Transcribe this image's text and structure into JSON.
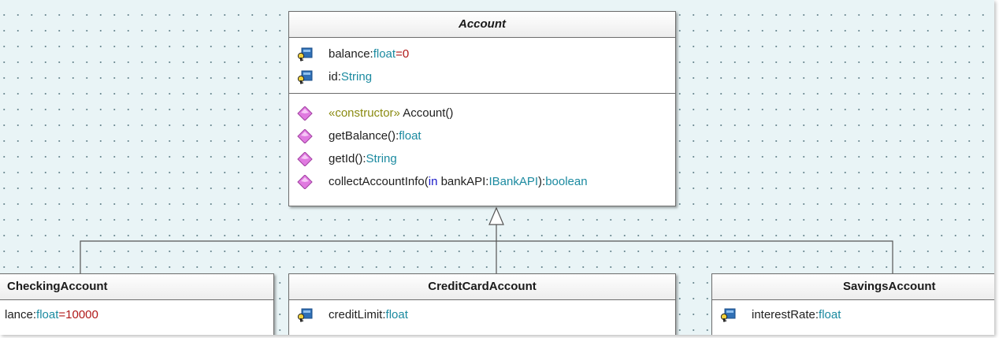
{
  "diagram": {
    "classes": {
      "account": {
        "name": "Account",
        "attributes": [
          {
            "name": "balance",
            "sep": ":",
            "type": "float",
            "eq": "=",
            "default": "0",
            "icon": "attribute-key-icon"
          },
          {
            "name": "id",
            "sep": ":",
            "type": "String",
            "icon": "attribute-key-icon"
          }
        ],
        "operations": [
          {
            "stereotype": "«constructor»",
            "name": " Account()",
            "icon": "operation-diamond-icon"
          },
          {
            "name": "getBalance()",
            "sep": ":",
            "type": "float",
            "icon": "operation-diamond-icon"
          },
          {
            "name": "getId()",
            "sep": ":",
            "type": "String",
            "icon": "operation-diamond-icon"
          },
          {
            "name": "collectAccountInfo(",
            "kw": "in",
            "param": " bankAPI",
            "sep": ":",
            "ptype": "IBankAPI",
            "close": "):",
            "type": "boolean",
            "icon": "operation-diamond-icon"
          }
        ]
      },
      "checking": {
        "name": "CheckingAccount",
        "attributes": [
          {
            "name": "lance",
            "sep": ":",
            "type": "float",
            "eq": "=",
            "default": "10000"
          }
        ]
      },
      "creditcard": {
        "name": "CreditCardAccount",
        "attributes": [
          {
            "name": "creditLimit",
            "sep": ":",
            "type": "float",
            "icon": "attribute-key-icon"
          }
        ]
      },
      "savings": {
        "name": "SavingsAccount",
        "attributes": [
          {
            "name": "interestRate",
            "sep": ":",
            "type": "float",
            "icon": "attribute-key-icon"
          }
        ]
      }
    },
    "colors": {
      "canvas": "#e9f4f6",
      "grid_dot": "#6f8c94",
      "type": "#1b8aa0",
      "default_value": "#b01818",
      "keyword": "#1818c8",
      "stereotype": "#8a8a10",
      "operation_icon": "#e07ae0"
    }
  }
}
